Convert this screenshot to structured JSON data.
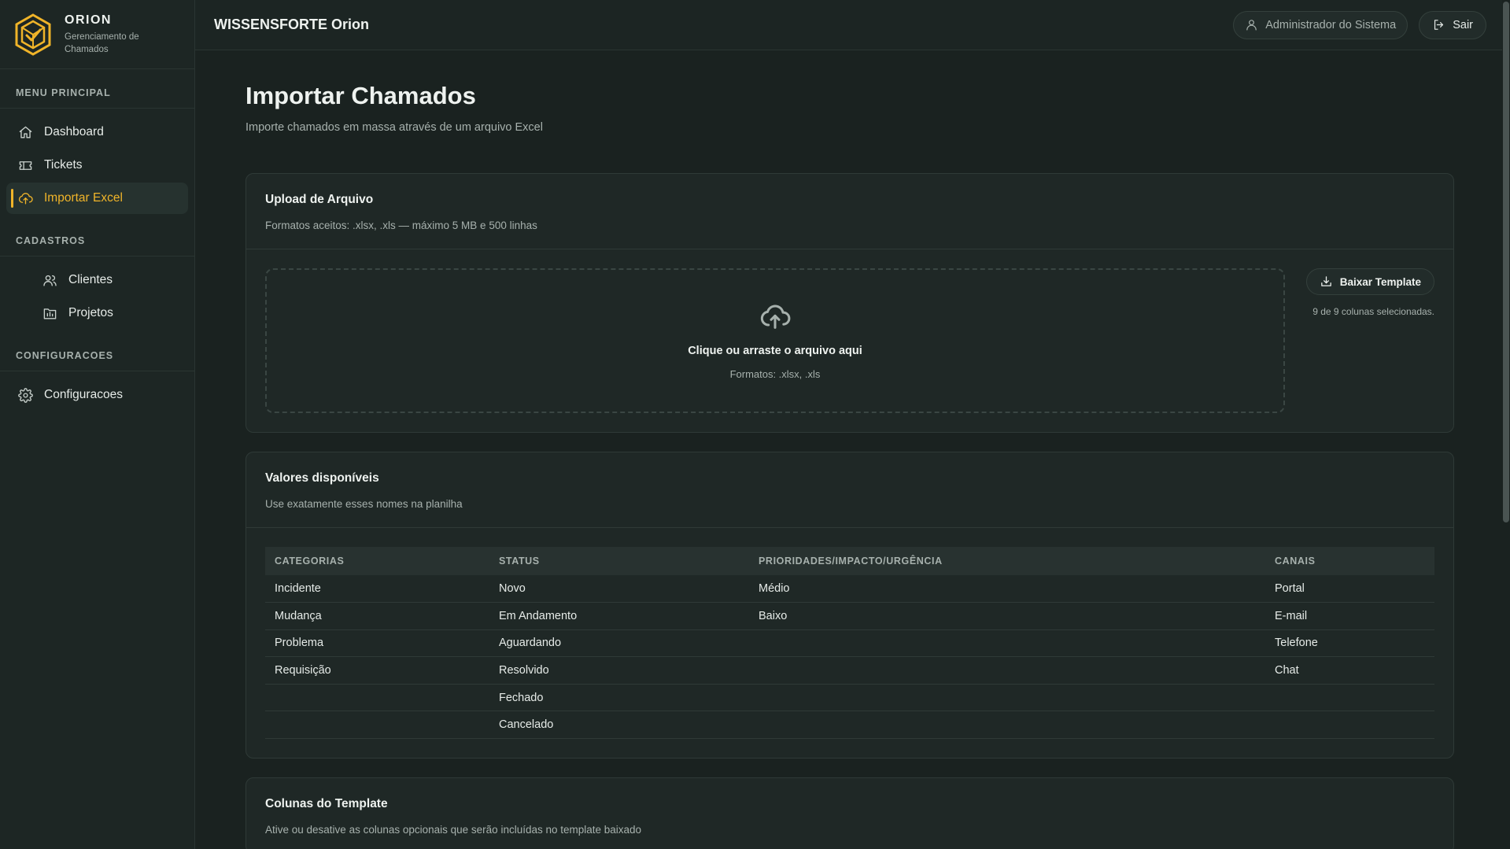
{
  "brand": {
    "name": "ORION",
    "subtitle": "Gerenciamento de Chamados",
    "accent_color": "#f0b429"
  },
  "sidebar": {
    "sections": [
      {
        "title": "MENU PRINCIPAL",
        "items": [
          {
            "label": "Dashboard",
            "icon": "home-icon"
          },
          {
            "label": "Tickets",
            "icon": "ticket-icon"
          },
          {
            "label": "Importar Excel",
            "icon": "cloud-upload-icon",
            "active": true
          }
        ]
      },
      {
        "title": "CADASTROS",
        "items": [
          {
            "label": "Clientes",
            "icon": "users-icon"
          },
          {
            "label": "Projetos",
            "icon": "folder-chart-icon"
          }
        ]
      },
      {
        "title": "CONFIGURACOES",
        "items": [
          {
            "label": "Configuracoes",
            "icon": "gear-icon"
          }
        ]
      }
    ]
  },
  "header": {
    "title": "WISSENSFORTE Orion",
    "user_label": "Administrador do Sistema",
    "logout_label": "Sair"
  },
  "page": {
    "title": "Importar Chamados",
    "subtitle": "Importe chamados em massa através de um arquivo Excel"
  },
  "upload_card": {
    "title": "Upload de Arquivo",
    "description": "Formatos aceitos: .xlsx, .xls — máximo 5 MB e 500 linhas",
    "drop_title": "Clique ou arraste o arquivo aqui",
    "drop_formats": "Formatos: .xlsx, .xls",
    "template_button": "Baixar Template",
    "columns_selected": "9 de 9 colunas selecionadas."
  },
  "values_card": {
    "title": "Valores disponíveis",
    "description": "Use exatamente esses nomes na planilha",
    "headers": [
      "CATEGORIAS",
      "STATUS",
      "PRIORIDADES/IMPACTO/URGÊNCIA",
      "CANAIS"
    ],
    "rows": [
      [
        "Incidente",
        "Novo",
        "Médio",
        "Portal"
      ],
      [
        "Mudança",
        "Em Andamento",
        "Baixo",
        "E-mail"
      ],
      [
        "Problema",
        "Aguardando",
        "",
        "Telefone"
      ],
      [
        "Requisição",
        "Resolvido",
        "",
        "Chat"
      ],
      [
        "",
        "Fechado",
        "",
        ""
      ],
      [
        "",
        "Cancelado",
        "",
        ""
      ]
    ]
  },
  "columns_card": {
    "title": "Colunas do Template",
    "description": "Ative ou desative as colunas opcionais que serão incluídas no template baixado"
  }
}
